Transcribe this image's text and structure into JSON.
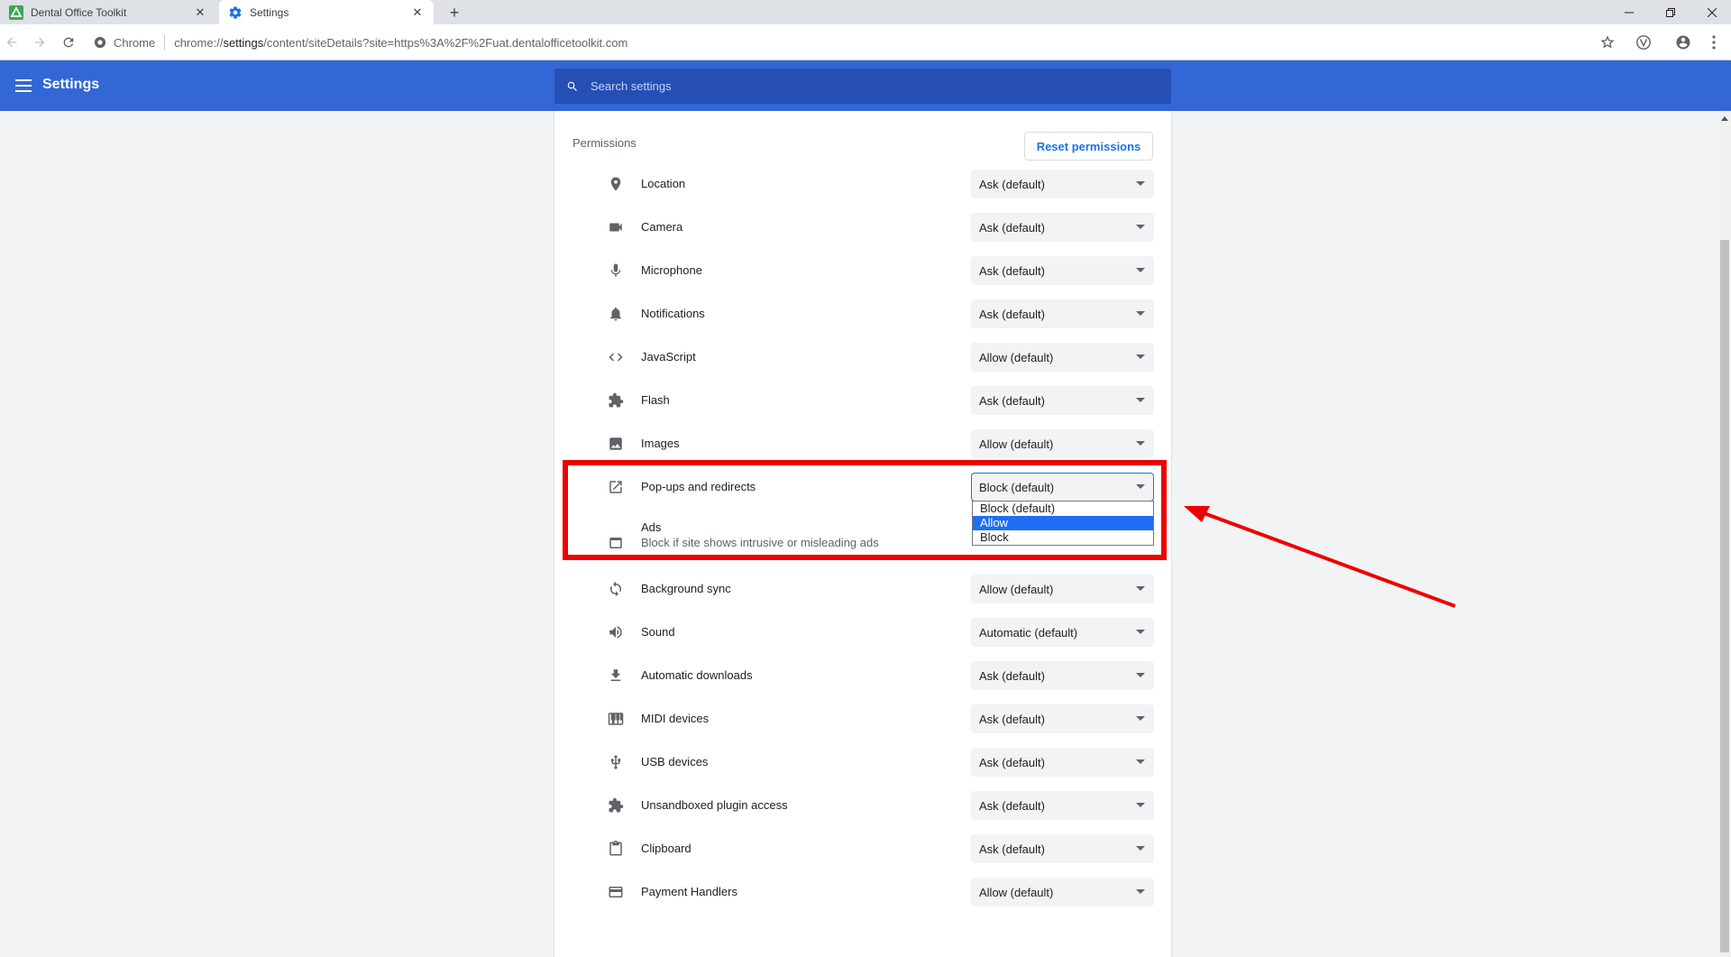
{
  "browser": {
    "tabs": [
      {
        "title": "Dental Office Toolkit",
        "active": false
      },
      {
        "title": "Settings",
        "active": true
      }
    ],
    "omnibox": {
      "chip": "Chrome",
      "url_prefix": "chrome://",
      "url_host": "settings",
      "url_path": "/content/siteDetails?site=https%3A%2F%2Fuat.dentalofficetoolkit.com"
    }
  },
  "header": {
    "title": "Settings",
    "search_placeholder": "Search settings"
  },
  "permissions": {
    "heading": "Permissions",
    "reset_label": "Reset permissions",
    "rows": [
      {
        "icon": "location-icon",
        "label": "Location",
        "value": "Ask (default)"
      },
      {
        "icon": "camera-icon",
        "label": "Camera",
        "value": "Ask (default)"
      },
      {
        "icon": "microphone-icon",
        "label": "Microphone",
        "value": "Ask (default)"
      },
      {
        "icon": "notifications-icon",
        "label": "Notifications",
        "value": "Ask (default)"
      },
      {
        "icon": "code-icon",
        "label": "JavaScript",
        "value": "Allow (default)"
      },
      {
        "icon": "puzzle-icon",
        "label": "Flash",
        "value": "Ask (default)"
      },
      {
        "icon": "image-icon",
        "label": "Images",
        "value": "Allow (default)"
      },
      {
        "icon": "open-in-new-icon",
        "label": "Pop-ups and redirects",
        "value": "Block (default)"
      },
      {
        "icon": "ads-icon",
        "label": "Ads",
        "sublabel": "Block if site shows intrusive or misleading ads"
      },
      {
        "icon": "sync-icon",
        "label": "Background sync",
        "value": "Allow (default)"
      },
      {
        "icon": "volume-icon",
        "label": "Sound",
        "value": "Automatic (default)"
      },
      {
        "icon": "download-icon",
        "label": "Automatic downloads",
        "value": "Ask (default)"
      },
      {
        "icon": "piano-icon",
        "label": "MIDI devices",
        "value": "Ask (default)"
      },
      {
        "icon": "usb-icon",
        "label": "USB devices",
        "value": "Ask (default)"
      },
      {
        "icon": "puzzle-icon",
        "label": "Unsandboxed plugin access",
        "value": "Ask (default)"
      },
      {
        "icon": "clipboard-icon",
        "label": "Clipboard",
        "value": "Ask (default)"
      },
      {
        "icon": "credit-card-icon",
        "label": "Payment Handlers",
        "value": "Allow (default)"
      }
    ],
    "popup_dropdown_options": [
      "Block (default)",
      "Allow",
      "Block"
    ],
    "popup_dropdown_highlighted": "Allow"
  },
  "annotation": {
    "highlight_color": "#ee0000"
  },
  "colors": {
    "header_blue": "#3367d6",
    "search_blue": "#254fb5",
    "link_blue": "#1a73e8",
    "option_selected": "#1e6ef5"
  }
}
